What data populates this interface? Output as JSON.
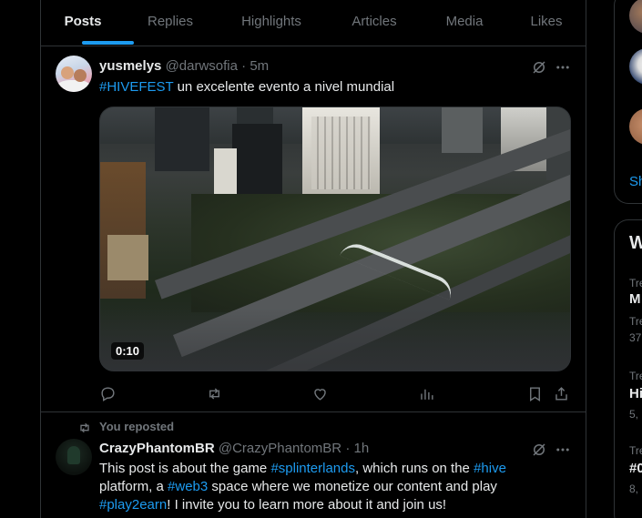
{
  "tabs": [
    {
      "label": "Posts",
      "active": true
    },
    {
      "label": "Replies",
      "active": false
    },
    {
      "label": "Highlights",
      "active": false
    },
    {
      "label": "Articles",
      "active": false
    },
    {
      "label": "Media",
      "active": false
    },
    {
      "label": "Likes",
      "active": false
    }
  ],
  "colors": {
    "accent": "#1d9bf0",
    "muted": "#71767b",
    "text": "#e7e9ea",
    "border": "#2f3336"
  },
  "post1": {
    "name": "yusmelys",
    "handle": "@darwsofia",
    "dot": "·",
    "time": "5m",
    "text_hashtag": "#HIVEFEST",
    "text_rest": " un excelente evento a nivel mundial",
    "video_duration": "0:10",
    "actions": [
      "reply-icon",
      "repost-icon",
      "like-icon",
      "views-icon",
      "bookmark-icon",
      "share-icon"
    ]
  },
  "post2": {
    "reposted_label": "You reposted",
    "name": "CrazyPhantomBR",
    "handle": "@CrazyPhantomBR",
    "dot": "·",
    "time": "1h",
    "text": {
      "t1": "This post is about the game ",
      "h1": "#splinterlands",
      "t2": ", which runs on the ",
      "h2": "#hive",
      "t3": "platform, a ",
      "h3": "#web3",
      "t4": " space where we monetize our content and play",
      "h4": "#play2earn",
      "t5": "! I invite you to learn more about it and join us!"
    }
  },
  "sidebar": {
    "show_more": "Sh",
    "section_title": "W",
    "trends": [
      {
        "context": "Tre",
        "title": "M",
        "count": "Tre"
      },
      {
        "context": "37",
        "title": "",
        "count": ""
      },
      {
        "context": "Tre",
        "title": "Hi",
        "count": "5,"
      },
      {
        "context": "Tre",
        "title": "#0",
        "count": "8,"
      }
    ]
  }
}
